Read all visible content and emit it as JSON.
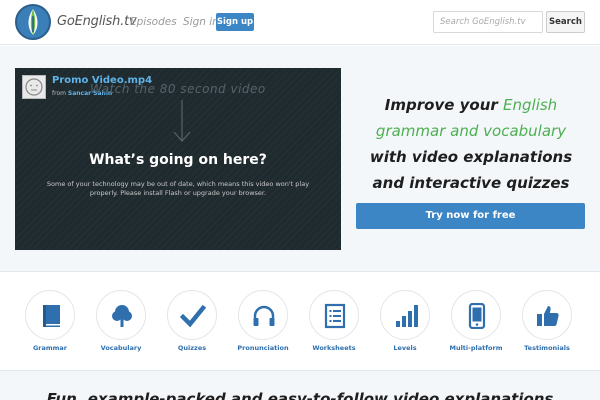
{
  "header": {
    "brand": "GoEnglish.tv",
    "nav": {
      "episodes": "Episodes",
      "signin": "Sign in",
      "signup": "Sign up"
    },
    "search": {
      "placeholder": "Search GoEnglish.tv",
      "button": "Search"
    }
  },
  "hero": {
    "video": {
      "title": "Promo Video.mp4",
      "from_label": "from",
      "author": "Sancar Sahin",
      "handwritten": "Watch the 80 second video",
      "heading": "What’s going on here?",
      "message": "Some of your technology may be out of date, which means this video won't play properly. Please install Flash or upgrade your browser."
    },
    "tagline": {
      "l1a": "Improve your ",
      "l1b": "English",
      "l2": "grammar and vocabulary",
      "l3": "with video explanations",
      "l4": "and interactive quizzes"
    },
    "cta": "Try now for free"
  },
  "features": [
    {
      "label": "Grammar",
      "icon": "book-icon"
    },
    {
      "label": "Vocabulary",
      "icon": "tree-icon"
    },
    {
      "label": "Quizzes",
      "icon": "checkmark-icon"
    },
    {
      "label": "Pronunciation",
      "icon": "headphones-icon"
    },
    {
      "label": "Worksheets",
      "icon": "worksheet-icon"
    },
    {
      "label": "Levels",
      "icon": "bar-levels-icon"
    },
    {
      "label": "Multi-platform",
      "icon": "phone-icon"
    },
    {
      "label": "Testimonials",
      "icon": "thumbs-up-icon"
    }
  ],
  "bottom": {
    "text": "Fun, example-packed and easy-to-follow video explanations"
  },
  "colors": {
    "accent": "#3d86c6",
    "icon": "#2f6fae",
    "green": "#4caf50"
  }
}
